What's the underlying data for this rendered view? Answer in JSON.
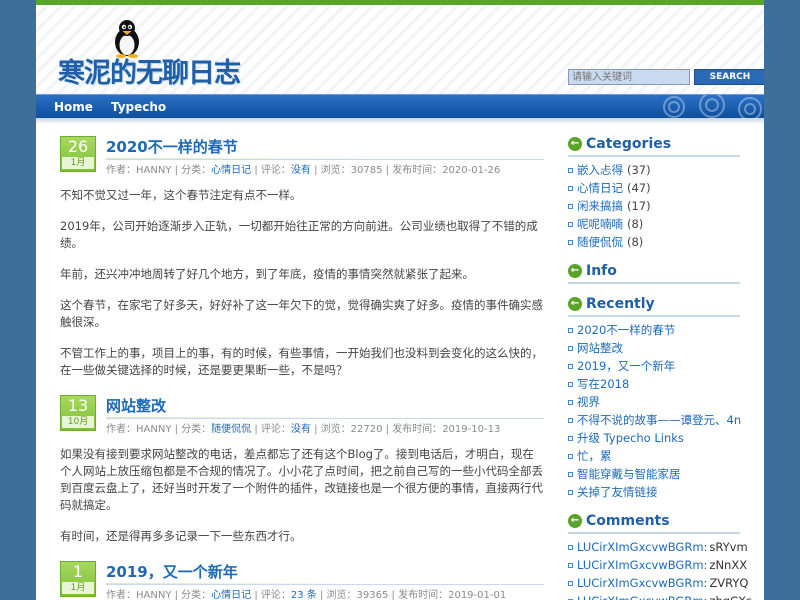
{
  "site": {
    "title": "寒泥的无聊日志",
    "search_placeholder": "请输入关键词",
    "search_button": "SEARCH"
  },
  "nav": [
    {
      "label": "Home"
    },
    {
      "label": "Typecho"
    }
  ],
  "posts": [
    {
      "day": "26",
      "month": "1月",
      "title": "2020不一样的春节",
      "author_label": "作者：",
      "author": "HANNY",
      "category_label": "分类：",
      "category": "心情日记",
      "comments_label": "评论：",
      "comments": "没有",
      "views_label": "浏览：",
      "views": "30785",
      "date_label": "发布时间：",
      "date": "2020-01-26",
      "paragraphs": [
        "不知不觉又过一年，这个春节注定有点不一样。",
        "2019年，公司开始逐渐步入正轨，一切都开始往正常的方向前进。公司业绩也取得了不错的成绩。",
        "年前，还兴冲冲地周转了好几个地方，到了年底，疫情的事情突然就紧张了起来。",
        "这个春节，在家宅了好多天，好好补了这一年欠下的觉，觉得确实爽了好多。疫情的事件确实感触很深。",
        "不管工作上的事，项目上的事，有的时候，有些事情，一开始我们也没料到会变化的这么快的，在一些做关键选择的时候，还是要更果断一些，不是吗？"
      ]
    },
    {
      "day": "13",
      "month": "10月",
      "title": "网站整改",
      "author_label": "作者：",
      "author": "HANNY",
      "category_label": "分类：",
      "category": "随便侃侃",
      "comments_label": "评论：",
      "comments": "没有",
      "views_label": "浏览：",
      "views": "22720",
      "date_label": "发布时间：",
      "date": "2019-10-13",
      "paragraphs": [
        "如果没有接到要求网站整改的电话，差点都忘了还有这个Blog了。接到电话后，才明白，现在个人网站上放压缩包都是不合规的情况了。小小花了点时间，把之前自己写的一些小代码全部丢到百度云盘上了，还好当时开发了一个附件的插件，改链接也是一个很方便的事情，直接两行代码就搞定。",
        "有时间，还是得再多多记录一下一些东西才行。"
      ]
    },
    {
      "day": "1",
      "month": "1月",
      "title": "2019，又一个新年",
      "author_label": "作者：",
      "author": "HANNY",
      "category_label": "分类：",
      "category": "心情日记",
      "comments_label": "评论：",
      "comments": "23 条",
      "views_label": "浏览：",
      "views": "39365",
      "date_label": "发布时间：",
      "date": "2019-01-01",
      "paragraphs": []
    }
  ],
  "sidebar": {
    "categories_title": "Categories",
    "categories": [
      {
        "name": "嵌入忐得",
        "count": "(37)"
      },
      {
        "name": "心情日记",
        "count": "(47)"
      },
      {
        "name": "闲来搞搞",
        "count": "(17)"
      },
      {
        "name": "呢呢喃喃",
        "count": "(8)"
      },
      {
        "name": "随便侃侃",
        "count": "(8)"
      }
    ],
    "info_title": "Info",
    "recently_title": "Recently",
    "recent": [
      "2020不一样的春节",
      "网站整改",
      "2019，又一个新年",
      "写在2018",
      "视界",
      "不得不说的故事——谭登元、4n",
      "升级 Typecho Links",
      "忙，累",
      "智能穿戴与智能家居",
      "关掉了友情链接"
    ],
    "comments_title": "Comments",
    "comments": [
      {
        "name": "LUCirXImGxcvwBGRm:",
        "text": "sRYvm"
      },
      {
        "name": "LUCirXImGxcvwBGRm:",
        "text": "zNnXX"
      },
      {
        "name": "LUCirXImGxcvwBGRm:",
        "text": "ZVRYQ"
      },
      {
        "name": "LUCirXImGxcvwBGRm:",
        "text": "zbgCXs"
      }
    ]
  },
  "colors": {
    "accent_green": "#5aa42a",
    "link_blue": "#1e6ab8",
    "nav_blue": "#0e4f9d",
    "page_bg": "#3d6f99"
  }
}
